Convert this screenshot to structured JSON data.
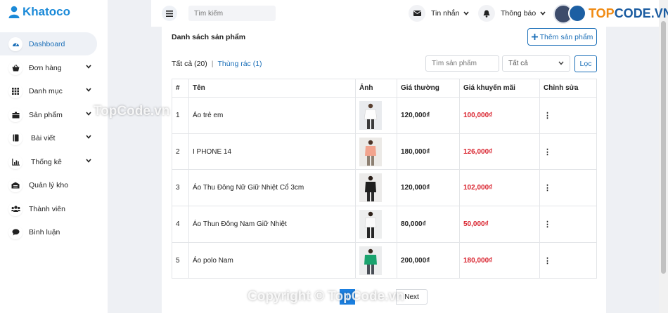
{
  "brand": "Khatoco",
  "sidebar": {
    "items": [
      {
        "label": "Dashboard",
        "icon": "gauge-icon",
        "active": true
      },
      {
        "label": "Đơn hàng",
        "icon": "basket-icon"
      },
      {
        "label": "Danh mục",
        "icon": "grid-icon"
      },
      {
        "label": "Sản phẩm",
        "icon": "box-icon"
      },
      {
        "label": "Bài viết",
        "icon": "book-icon"
      },
      {
        "label": "Thống kê",
        "icon": "chart-icon"
      },
      {
        "label": "Quản lý kho",
        "icon": "warehouse-icon"
      },
      {
        "label": "Thành viên",
        "icon": "users-icon"
      },
      {
        "label": "Bình luận",
        "icon": "comment-icon"
      }
    ]
  },
  "topbar": {
    "search_placeholder": "Tìm kiếm",
    "messages": "Tin nhắn",
    "notifications": "Thông báo"
  },
  "main": {
    "title": "Danh sách sản phẩm",
    "add_button": "Thêm sản phẩm",
    "filter_all": "Tất cả (20)",
    "filter_sep": "|",
    "filter_trash": "Thùng rác (1)",
    "search_placeholder": "Tìm sản phẩm",
    "select_value": "Tất cả",
    "filter_button": "Lọc",
    "columns": [
      "#",
      "Tên",
      "Ảnh",
      "Giá thường",
      "Giá khuyến mãi",
      "Chỉnh sửa"
    ],
    "rows": [
      {
        "num": "1",
        "name": "Áo trẻ em",
        "price": "120,000₫",
        "sale": "100,000₫"
      },
      {
        "num": "2",
        "name": "I PHONE 14",
        "price": "180,000₫",
        "sale": "126,000₫"
      },
      {
        "num": "3",
        "name": "Áo Thu Đông Nữ Giữ Nhiệt Cổ 3cm",
        "price": "120,000₫",
        "sale": "102,000₫"
      },
      {
        "num": "4",
        "name": "Áo Thun Đông Nam Giữ Nhiệt",
        "price": "80,000₫",
        "sale": "50,000₫"
      },
      {
        "num": "5",
        "name": "Áo polo Nam",
        "price": "200,000₫",
        "sale": "180,000₫"
      }
    ],
    "pagination": {
      "current": "1",
      "next": "Next"
    }
  },
  "watermarks": {
    "logo_text_a": "TOP",
    "logo_text_b": "CODE.VN",
    "mid": "TopCode.vn",
    "bottom": "Copyright © TopCode.vn"
  },
  "colors": {
    "accent": "#1b6fb8",
    "sale": "#d9232e",
    "active_page": "#1b7fe0"
  }
}
